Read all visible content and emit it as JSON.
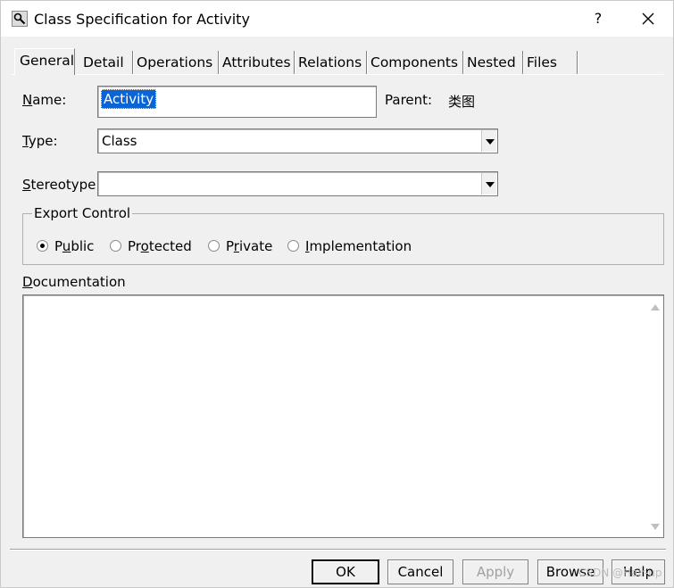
{
  "window": {
    "title": "Class Specification for Activity",
    "help_label": "?"
  },
  "tabs": [
    "General",
    "Detail",
    "Operations",
    "Attributes",
    "Relations",
    "Components",
    "Nested",
    "Files"
  ],
  "active_tab": "General",
  "form": {
    "name_label": "Name:",
    "name_value": "Activity",
    "parent_label": "Parent:",
    "parent_value": "类图",
    "type_label": "Type:",
    "type_value": "Class",
    "stereotype_label": "Stereotype:",
    "stereotype_value": ""
  },
  "export_control": {
    "group_label": "Export Control",
    "options": [
      "Public",
      "Protected",
      "Private",
      "Implementation"
    ],
    "selected": "Public"
  },
  "documentation": {
    "label": "Documentation",
    "value": ""
  },
  "buttons": {
    "ok": "OK",
    "cancel": "Cancel",
    "apply": "Apply",
    "browse": "Browse",
    "help": "Help"
  },
  "watermark": "CSDN @Hair-up"
}
